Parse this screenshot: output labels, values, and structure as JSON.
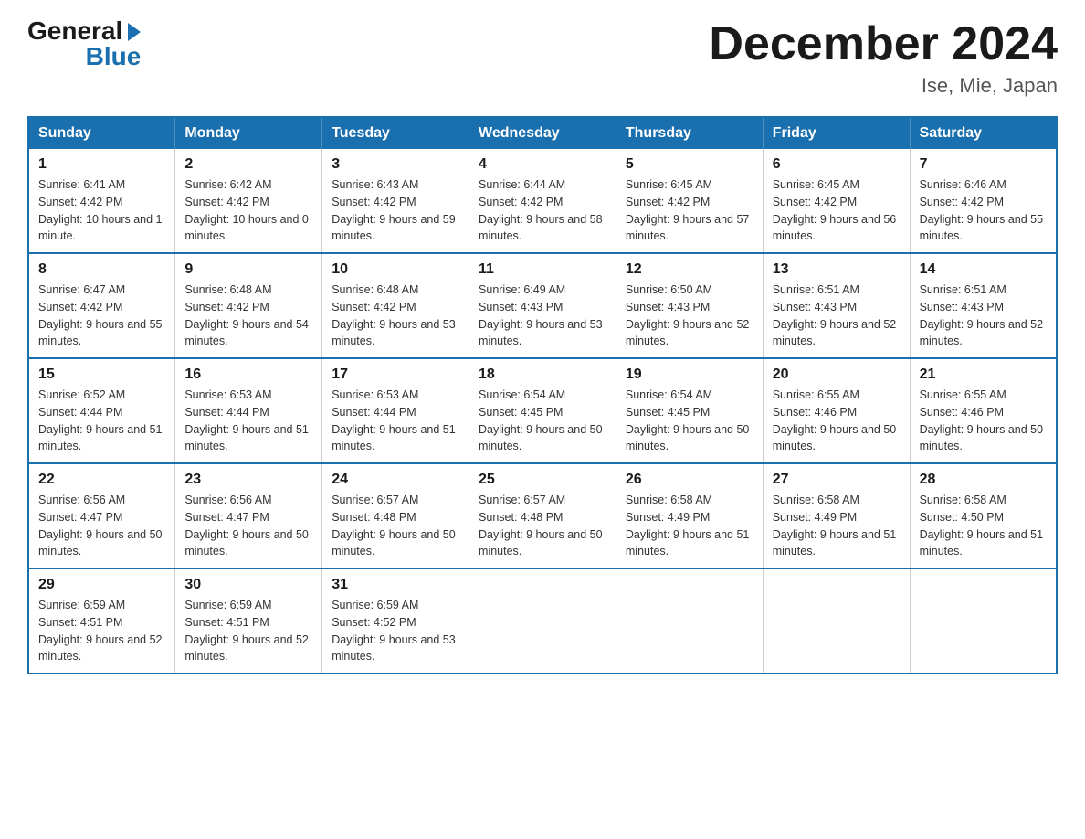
{
  "logo": {
    "general": "General",
    "blue": "Blue",
    "arrow": "▶"
  },
  "title": "December 2024",
  "subtitle": "Ise, Mie, Japan",
  "weekdays": [
    "Sunday",
    "Monday",
    "Tuesday",
    "Wednesday",
    "Thursday",
    "Friday",
    "Saturday"
  ],
  "weeks": [
    [
      {
        "day": "1",
        "sunrise": "6:41 AM",
        "sunset": "4:42 PM",
        "daylight": "10 hours and 1 minute."
      },
      {
        "day": "2",
        "sunrise": "6:42 AM",
        "sunset": "4:42 PM",
        "daylight": "10 hours and 0 minutes."
      },
      {
        "day": "3",
        "sunrise": "6:43 AM",
        "sunset": "4:42 PM",
        "daylight": "9 hours and 59 minutes."
      },
      {
        "day": "4",
        "sunrise": "6:44 AM",
        "sunset": "4:42 PM",
        "daylight": "9 hours and 58 minutes."
      },
      {
        "day": "5",
        "sunrise": "6:45 AM",
        "sunset": "4:42 PM",
        "daylight": "9 hours and 57 minutes."
      },
      {
        "day": "6",
        "sunrise": "6:45 AM",
        "sunset": "4:42 PM",
        "daylight": "9 hours and 56 minutes."
      },
      {
        "day": "7",
        "sunrise": "6:46 AM",
        "sunset": "4:42 PM",
        "daylight": "9 hours and 55 minutes."
      }
    ],
    [
      {
        "day": "8",
        "sunrise": "6:47 AM",
        "sunset": "4:42 PM",
        "daylight": "9 hours and 55 minutes."
      },
      {
        "day": "9",
        "sunrise": "6:48 AM",
        "sunset": "4:42 PM",
        "daylight": "9 hours and 54 minutes."
      },
      {
        "day": "10",
        "sunrise": "6:48 AM",
        "sunset": "4:42 PM",
        "daylight": "9 hours and 53 minutes."
      },
      {
        "day": "11",
        "sunrise": "6:49 AM",
        "sunset": "4:43 PM",
        "daylight": "9 hours and 53 minutes."
      },
      {
        "day": "12",
        "sunrise": "6:50 AM",
        "sunset": "4:43 PM",
        "daylight": "9 hours and 52 minutes."
      },
      {
        "day": "13",
        "sunrise": "6:51 AM",
        "sunset": "4:43 PM",
        "daylight": "9 hours and 52 minutes."
      },
      {
        "day": "14",
        "sunrise": "6:51 AM",
        "sunset": "4:43 PM",
        "daylight": "9 hours and 52 minutes."
      }
    ],
    [
      {
        "day": "15",
        "sunrise": "6:52 AM",
        "sunset": "4:44 PM",
        "daylight": "9 hours and 51 minutes."
      },
      {
        "day": "16",
        "sunrise": "6:53 AM",
        "sunset": "4:44 PM",
        "daylight": "9 hours and 51 minutes."
      },
      {
        "day": "17",
        "sunrise": "6:53 AM",
        "sunset": "4:44 PM",
        "daylight": "9 hours and 51 minutes."
      },
      {
        "day": "18",
        "sunrise": "6:54 AM",
        "sunset": "4:45 PM",
        "daylight": "9 hours and 50 minutes."
      },
      {
        "day": "19",
        "sunrise": "6:54 AM",
        "sunset": "4:45 PM",
        "daylight": "9 hours and 50 minutes."
      },
      {
        "day": "20",
        "sunrise": "6:55 AM",
        "sunset": "4:46 PM",
        "daylight": "9 hours and 50 minutes."
      },
      {
        "day": "21",
        "sunrise": "6:55 AM",
        "sunset": "4:46 PM",
        "daylight": "9 hours and 50 minutes."
      }
    ],
    [
      {
        "day": "22",
        "sunrise": "6:56 AM",
        "sunset": "4:47 PM",
        "daylight": "9 hours and 50 minutes."
      },
      {
        "day": "23",
        "sunrise": "6:56 AM",
        "sunset": "4:47 PM",
        "daylight": "9 hours and 50 minutes."
      },
      {
        "day": "24",
        "sunrise": "6:57 AM",
        "sunset": "4:48 PM",
        "daylight": "9 hours and 50 minutes."
      },
      {
        "day": "25",
        "sunrise": "6:57 AM",
        "sunset": "4:48 PM",
        "daylight": "9 hours and 50 minutes."
      },
      {
        "day": "26",
        "sunrise": "6:58 AM",
        "sunset": "4:49 PM",
        "daylight": "9 hours and 51 minutes."
      },
      {
        "day": "27",
        "sunrise": "6:58 AM",
        "sunset": "4:49 PM",
        "daylight": "9 hours and 51 minutes."
      },
      {
        "day": "28",
        "sunrise": "6:58 AM",
        "sunset": "4:50 PM",
        "daylight": "9 hours and 51 minutes."
      }
    ],
    [
      {
        "day": "29",
        "sunrise": "6:59 AM",
        "sunset": "4:51 PM",
        "daylight": "9 hours and 52 minutes."
      },
      {
        "day": "30",
        "sunrise": "6:59 AM",
        "sunset": "4:51 PM",
        "daylight": "9 hours and 52 minutes."
      },
      {
        "day": "31",
        "sunrise": "6:59 AM",
        "sunset": "4:52 PM",
        "daylight": "9 hours and 53 minutes."
      },
      null,
      null,
      null,
      null
    ]
  ]
}
